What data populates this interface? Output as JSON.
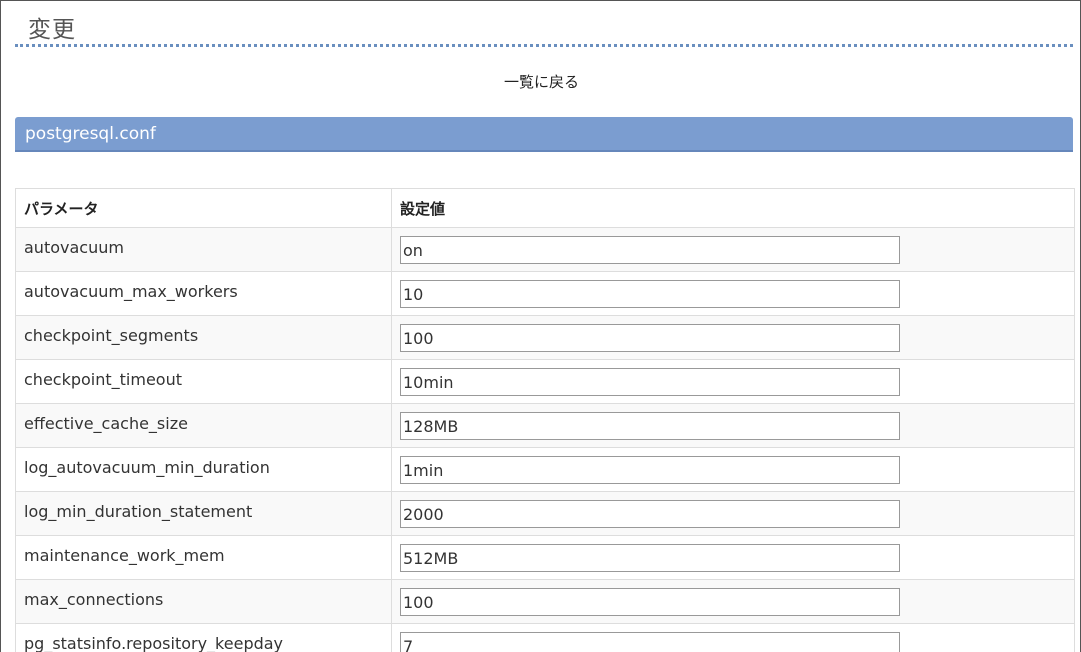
{
  "page": {
    "title": "変更",
    "back_link": "一覧に戻る"
  },
  "section": {
    "header": "postgresql.conf"
  },
  "table": {
    "columns": [
      "パラメータ",
      "設定値"
    ],
    "rows": [
      {
        "name": "autovacuum",
        "value": "on"
      },
      {
        "name": "autovacuum_max_workers",
        "value": "10"
      },
      {
        "name": "checkpoint_segments",
        "value": "100"
      },
      {
        "name": "checkpoint_timeout",
        "value": "10min"
      },
      {
        "name": "effective_cache_size",
        "value": "128MB"
      },
      {
        "name": "log_autovacuum_min_duration",
        "value": "1min"
      },
      {
        "name": "log_min_duration_statement",
        "value": "2000"
      },
      {
        "name": "maintenance_work_mem",
        "value": "512MB"
      },
      {
        "name": "max_connections",
        "value": "100"
      },
      {
        "name": "pg_statsinfo.repository_keepday",
        "value": "7"
      }
    ]
  },
  "colors": {
    "section_header_bg": "#7b9dd0",
    "title_rule": "#6a8fbf",
    "stripe_row": "#f9f9f9"
  }
}
